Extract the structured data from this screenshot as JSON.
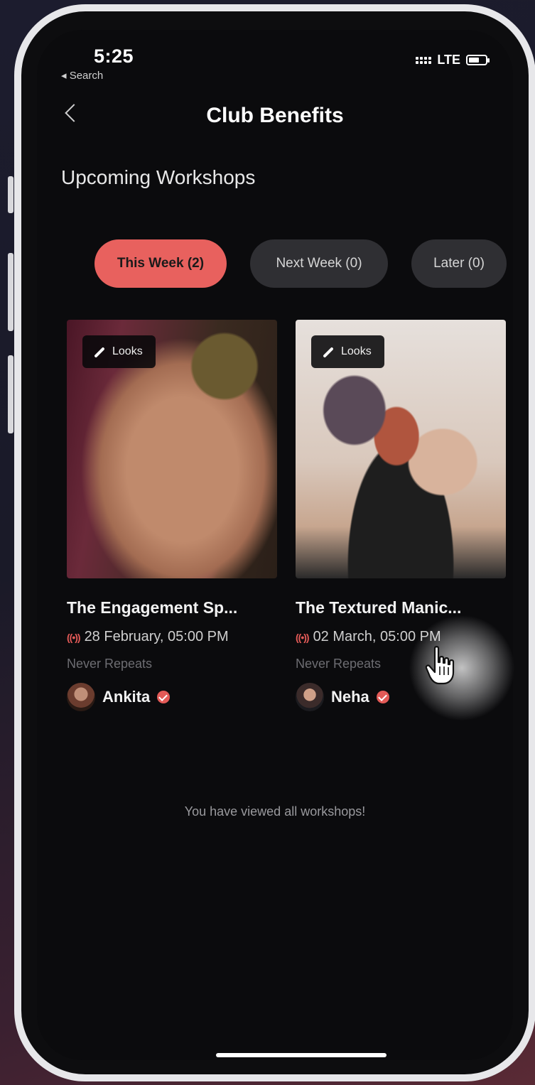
{
  "status_bar": {
    "time": "5:25",
    "back_label": "◂ Search",
    "network": "LTE"
  },
  "header": {
    "title": "Club Benefits"
  },
  "section_title": "Upcoming Workshops",
  "tabs": [
    {
      "label": "This Week (2)",
      "active": true
    },
    {
      "label": "Next Week (0)",
      "active": false
    },
    {
      "label": "Later (0)",
      "active": false
    }
  ],
  "workshops": [
    {
      "badge": "Looks",
      "title": "The Engagement Sp...",
      "date": "28 February, 05:00 PM",
      "repeat": "Never Repeats",
      "host": "Ankita"
    },
    {
      "badge": "Looks",
      "title": "The Textured Manic...",
      "date": "02 March, 05:00 PM",
      "repeat": "Never Repeats",
      "host": "Neha"
    }
  ],
  "empty_message": "You have viewed all workshops!",
  "colors": {
    "accent": "#e8615e",
    "background": "#0b0b0d",
    "tab_inactive": "#2f2f33"
  }
}
